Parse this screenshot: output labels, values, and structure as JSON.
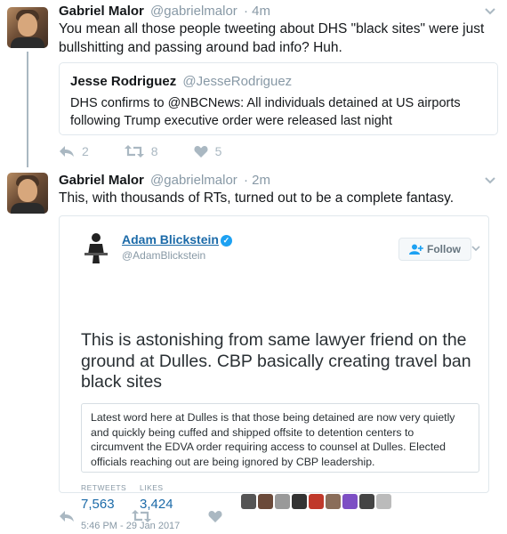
{
  "tweets": [
    {
      "name": "Gabriel Malor",
      "handle": "@gabrielmalor",
      "time": "· 4m",
      "text": "You mean all those people tweeting about DHS \"black sites\" were just bullshitting and passing around bad info? Huh.",
      "quote": {
        "name": "Jesse Rodriguez",
        "handle": "@JesseRodriguez",
        "text": "DHS confirms to @NBCNews: All individuals detained at US airports following Trump executive order were released last night"
      },
      "actions": {
        "reply_count": "2",
        "retweet_count": "8",
        "like_count": "5"
      }
    },
    {
      "name": "Gabriel Malor",
      "handle": "@gabrielmalor",
      "time": "· 2m",
      "text": "This, with thousands of RTs, turned out to be a complete fantasy.",
      "embed": {
        "name": "Adam Blickstein",
        "handle": "@AdamBlickstein",
        "follow_label": "Follow",
        "text": "This is astonishing from same lawyer friend on the ground at Dulles. CBP basically creating travel ban black sites",
        "inner_quote": "Latest word here at Dulles is that those being detained are now very quietly and quickly being cuffed and shipped offsite to detention centers to circumvent the EDVA order requiring access to counsel at Dulles. Elected officials reaching out are being ignored by CBP leadership.",
        "retweets_label": "RETWEETS",
        "retweets": "7,563",
        "likes_label": "LIKES",
        "likes": "3,424",
        "timestamp": "5:46 PM - 29 Jan 2017"
      },
      "actions": {
        "reply_count": "",
        "retweet_count": "",
        "like_count": ""
      }
    }
  ],
  "icons": [
    "reply-icon",
    "retweet-icon",
    "like-icon",
    "caret-down-icon",
    "verified-icon",
    "follow-person-icon"
  ],
  "colors": {
    "link": "#1b6aa8",
    "muted": "#8899a6",
    "action": "#aab8c2",
    "border": "#e1e8ed",
    "verified": "#1da1f2"
  }
}
